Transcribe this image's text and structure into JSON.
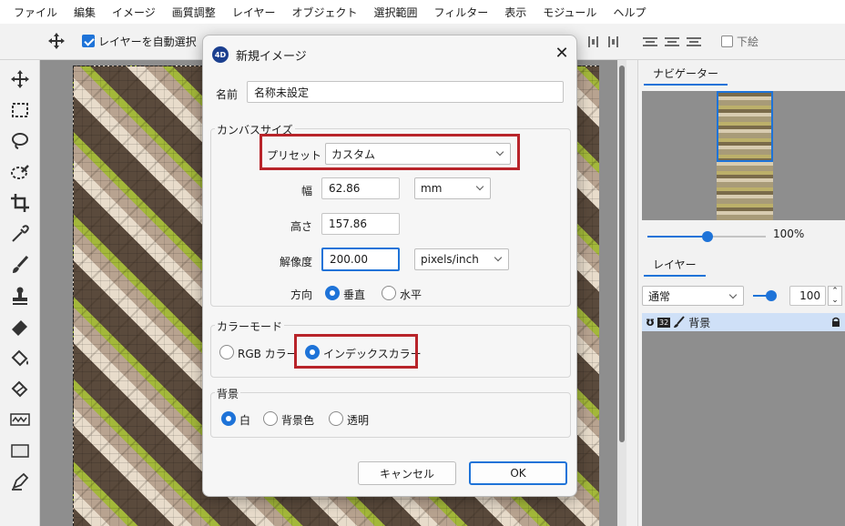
{
  "menu": [
    "ファイル",
    "編集",
    "イメージ",
    "画質調整",
    "レイヤー",
    "オブジェクト",
    "選択範囲",
    "フィルター",
    "表示",
    "モジュール",
    "ヘルプ"
  ],
  "options_bar": {
    "auto_select_label": "レイヤーを自動選択",
    "auto_select_checked": true,
    "subimage_label": "下絵",
    "subimage_checked": false
  },
  "tools": [
    "move-icon",
    "rect-select-icon",
    "lasso-icon",
    "magic-wand-icon",
    "crop-icon",
    "eyedropper-icon",
    "brush-icon",
    "stamp-icon",
    "eraser-icon",
    "fill-bucket-icon",
    "fill-bucket-alt-icon",
    "path-icon",
    "rectangle-icon",
    "pen-tool-icon"
  ],
  "right_panel": {
    "navigator_tab": "ナビゲーター",
    "zoom_label": "100%",
    "zoom_fraction": 0.5,
    "layers_tab": "レイヤー",
    "blend_mode": "通常",
    "opacity": "100",
    "layer": {
      "bits": "32",
      "name": "背景",
      "locked": true
    }
  },
  "dialog": {
    "app_badge": "4D",
    "title": "新規イメージ",
    "name_label": "名前",
    "name_value": "名称未設定",
    "canvas_group": "カンバスサイズ",
    "preset_label": "プリセット",
    "preset_value": "カスタム",
    "width_label": "幅",
    "width_value": "62.86",
    "unit_value": "mm",
    "height_label": "高さ",
    "height_value": "157.86",
    "resolution_label": "解像度",
    "resolution_value": "200.00",
    "resolution_unit": "pixels/inch",
    "orientation_label": "方向",
    "orientation_options": [
      "垂直",
      "水平"
    ],
    "orientation_selected": "垂直",
    "color_group": "カラーモード",
    "color_options": [
      "RGB カラー",
      "インデックスカラー"
    ],
    "color_selected": "インデックスカラー",
    "bg_group": "背景",
    "bg_options": [
      "白",
      "背景色",
      "透明"
    ],
    "bg_selected": "白",
    "cancel_label": "キャンセル",
    "ok_label": "OK"
  },
  "colors": {
    "accent": "#1e73d8",
    "highlight_red": "#b8242a",
    "app_badge": "#1b3f8f"
  }
}
